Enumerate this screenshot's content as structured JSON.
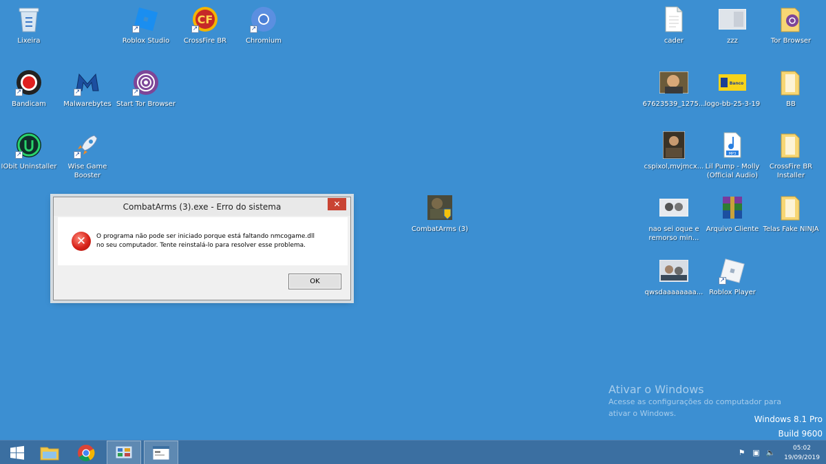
{
  "desktop": {
    "left_icons": [
      {
        "label": "Lixeira",
        "icon": "recycle-bin-icon"
      },
      {
        "label": "Roblox Studio",
        "icon": "roblox-studio-icon"
      },
      {
        "label": "CrossFire BR",
        "icon": "crossfire-icon"
      },
      {
        "label": "Chromium",
        "icon": "chromium-icon"
      },
      {
        "label": "Bandicam",
        "icon": "bandicam-icon"
      },
      {
        "label": "Malwarebytes",
        "icon": "malwarebytes-icon"
      },
      {
        "label": "Start Tor Browser",
        "icon": "tor-browser-icon"
      },
      {
        "label": "IObit Uninstaller",
        "icon": "iobit-uninstaller-icon"
      },
      {
        "label": "Wise Game Booster",
        "icon": "rocket-icon"
      }
    ],
    "center_icons": [
      {
        "label": "CombatArms (3)",
        "icon": "combatarms-icon"
      }
    ],
    "right_icons": [
      {
        "label": "cader",
        "icon": "document-icon"
      },
      {
        "label": "zzz",
        "icon": "image-thumbnail-icon"
      },
      {
        "label": "Tor Browser",
        "icon": "folder-icon"
      },
      {
        "label": "67623539_1275...",
        "icon": "image-thumbnail-icon"
      },
      {
        "label": "logo-bb-25-3-19",
        "icon": "image-thumbnail-icon"
      },
      {
        "label": "BB",
        "icon": "folder-icon"
      },
      {
        "label": "cspixol,mvjmcx...",
        "icon": "image-thumbnail-icon"
      },
      {
        "label": "Lil Pump - Molly (Official Audio)",
        "icon": "mp3-icon"
      },
      {
        "label": "CrossFire BR Installer",
        "icon": "folder-icon"
      },
      {
        "label": "nao sei oque e remorso min...",
        "icon": "image-thumbnail-icon"
      },
      {
        "label": "Arquivo Cliente",
        "icon": "winrar-icon"
      },
      {
        "label": "Telas Fake NINJA",
        "icon": "folder-icon"
      },
      {
        "label": "qwsdaaaaaaaa...",
        "icon": "image-thumbnail-icon"
      },
      {
        "label": "Roblox Player",
        "icon": "roblox-player-icon"
      }
    ]
  },
  "dialog": {
    "title": "CombatArms (3).exe - Erro do sistema",
    "message_line1": "O programa não pode ser iniciado porque está faltando nmcogame.dll",
    "message_line2": "no seu computador. Tente reinstalá-lo para resolver esse problema.",
    "ok_label": "OK",
    "close_glyph": "✕"
  },
  "watermark": {
    "title": "Ativar o Windows",
    "line1": "Acesse as configurações do computador para",
    "line2": "ativar o Windows."
  },
  "build_info": {
    "edition": "Windows 8.1 Pro",
    "build": "Build 9600"
  },
  "taskbar": {
    "apps": [
      "windows-start-icon",
      "file-explorer-icon",
      "chrome-icon",
      "control-panel-icon",
      "error-window-icon"
    ],
    "clock_time": "05:02",
    "clock_date": "19/09/2019"
  },
  "colors": {
    "desktop": "#3c8fd2",
    "taskbar": "#3b6fa1",
    "error_red": "#d8231a",
    "close_button": "#c94433"
  }
}
